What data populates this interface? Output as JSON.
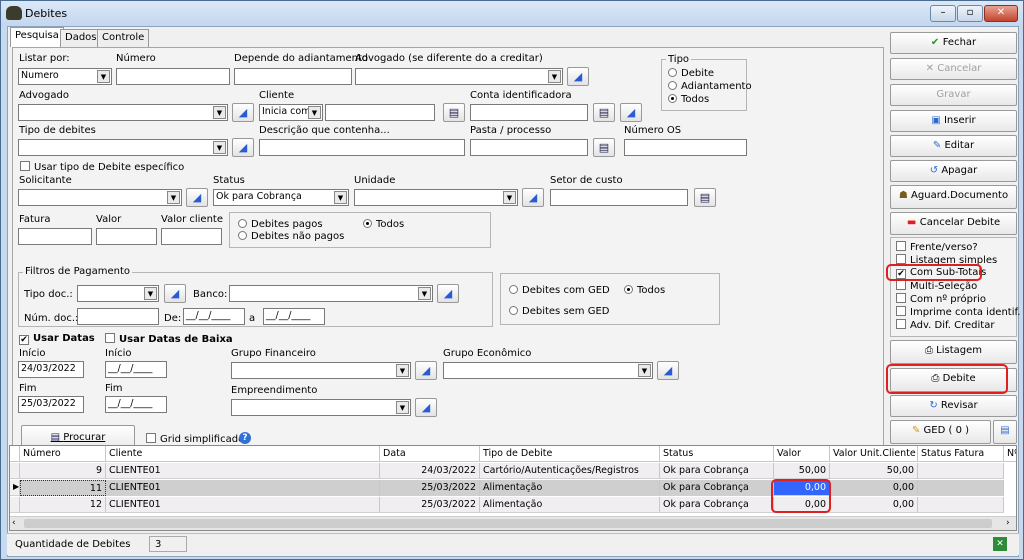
{
  "window": {
    "title": "Debites",
    "min": "–",
    "max": "▫",
    "close": "✕"
  },
  "tabs": [
    "Pesquisa",
    "Dados",
    "Controle"
  ],
  "form": {
    "listar_por_label": "Listar por:",
    "listar_por_value": "Numero",
    "numero_label": "Número",
    "depende_label": "Depende do adiantamento",
    "advogado_diff_label": "Advogado  (se diferente do a creditar)",
    "tipo_label": "Tipo",
    "tipo_opts": [
      "Debite",
      "Adiantamento",
      "Todos"
    ],
    "advogado_label": "Advogado",
    "cliente_label": "Cliente",
    "cliente_mode": "Inicia com",
    "conta_label": "Conta identificadora",
    "tipo_debites_label": "Tipo de debites",
    "descricao_label": "Descrição que contenha...",
    "pasta_label": "Pasta / processo",
    "numero_os_label": "Número OS",
    "usar_tipo_label": "Usar tipo de Debite específico",
    "solicitante_label": "Solicitante",
    "status_label": "Status",
    "status_value": "Ok para Cobrança",
    "unidade_label": "Unidade",
    "setor_label": "Setor de custo",
    "fatura_label": "Fatura",
    "valor_label": "Valor",
    "valor_cliente_label": "Valor cliente",
    "debites_pagos": "Debites pagos",
    "debites_nao_pagos": "Debites não pagos",
    "todos": "Todos",
    "filtros_pag_label": "Filtros de Pagamento",
    "tipo_doc_label": "Tipo doc.:",
    "banco_label": "Banco:",
    "num_doc_label": "Núm. doc.:",
    "de_label": "De:",
    "a_label": "a",
    "date_blank": "__/__/____",
    "ged_com": "Debites com GED",
    "ged_sem": "Debites sem GED",
    "usar_datas": "Usar Datas",
    "usar_datas_baixa": "Usar Datas de Baixa",
    "inicio_label": "Início",
    "inicio_value": "24/03/2022",
    "fim_label": "Fim",
    "fim_value": "25/03/2022",
    "grupo_fin_label": "Grupo Financeiro",
    "grupo_eco_label": "Grupo Econômico",
    "empreendimento_label": "Empreendimento",
    "procurar_label": "Procurar",
    "grid_simplificado": "Grid simplificado",
    "help": "?"
  },
  "side": {
    "fechar": "Fechar",
    "cancelar": "Cancelar",
    "gravar": "Gravar",
    "inserir": "Inserir",
    "editar": "Editar",
    "apagar": "Apagar",
    "aguard": "Aguard.Documento",
    "cancelar_debite": "Cancelar Debite",
    "checks": [
      {
        "label": "Frente/verso?",
        "checked": ""
      },
      {
        "label": "Listagem simples",
        "checked": ""
      },
      {
        "label": "Com Sub-Totais",
        "checked": "✔"
      },
      {
        "label": "Multi-Seleção",
        "checked": ""
      },
      {
        "label": "Com nº próprio",
        "checked": ""
      },
      {
        "label": "Imprime conta identif.",
        "checked": ""
      },
      {
        "label": "Adv. Dif. Creditar",
        "checked": ""
      }
    ],
    "listagem": "Listagem",
    "debite": "Debite",
    "revisar": "Revisar",
    "ged": "GED ( 0 )"
  },
  "grid": {
    "headers": [
      "Número",
      "Cliente",
      "Data",
      "Tipo de Debite",
      "Status",
      "Valor",
      "Valor Unit.Cliente",
      "Status Fatura",
      "Nº"
    ],
    "rows": [
      [
        "9",
        "CLIENTE01",
        "24/03/2022",
        "Cartório/Autenticações/Registros",
        "Ok para Cobrança",
        "50,00",
        "50,00",
        ""
      ],
      [
        "11",
        "CLIENTE01",
        "25/03/2022",
        "Alimentação",
        "Ok para Cobrança",
        "0,00",
        "0,00",
        ""
      ],
      [
        "12",
        "CLIENTE01",
        "25/03/2022",
        "Alimentação",
        "Ok para Cobrança",
        "0,00",
        "0,00",
        ""
      ]
    ]
  },
  "status": {
    "label": "Quantidade de Debites",
    "count": "3"
  }
}
